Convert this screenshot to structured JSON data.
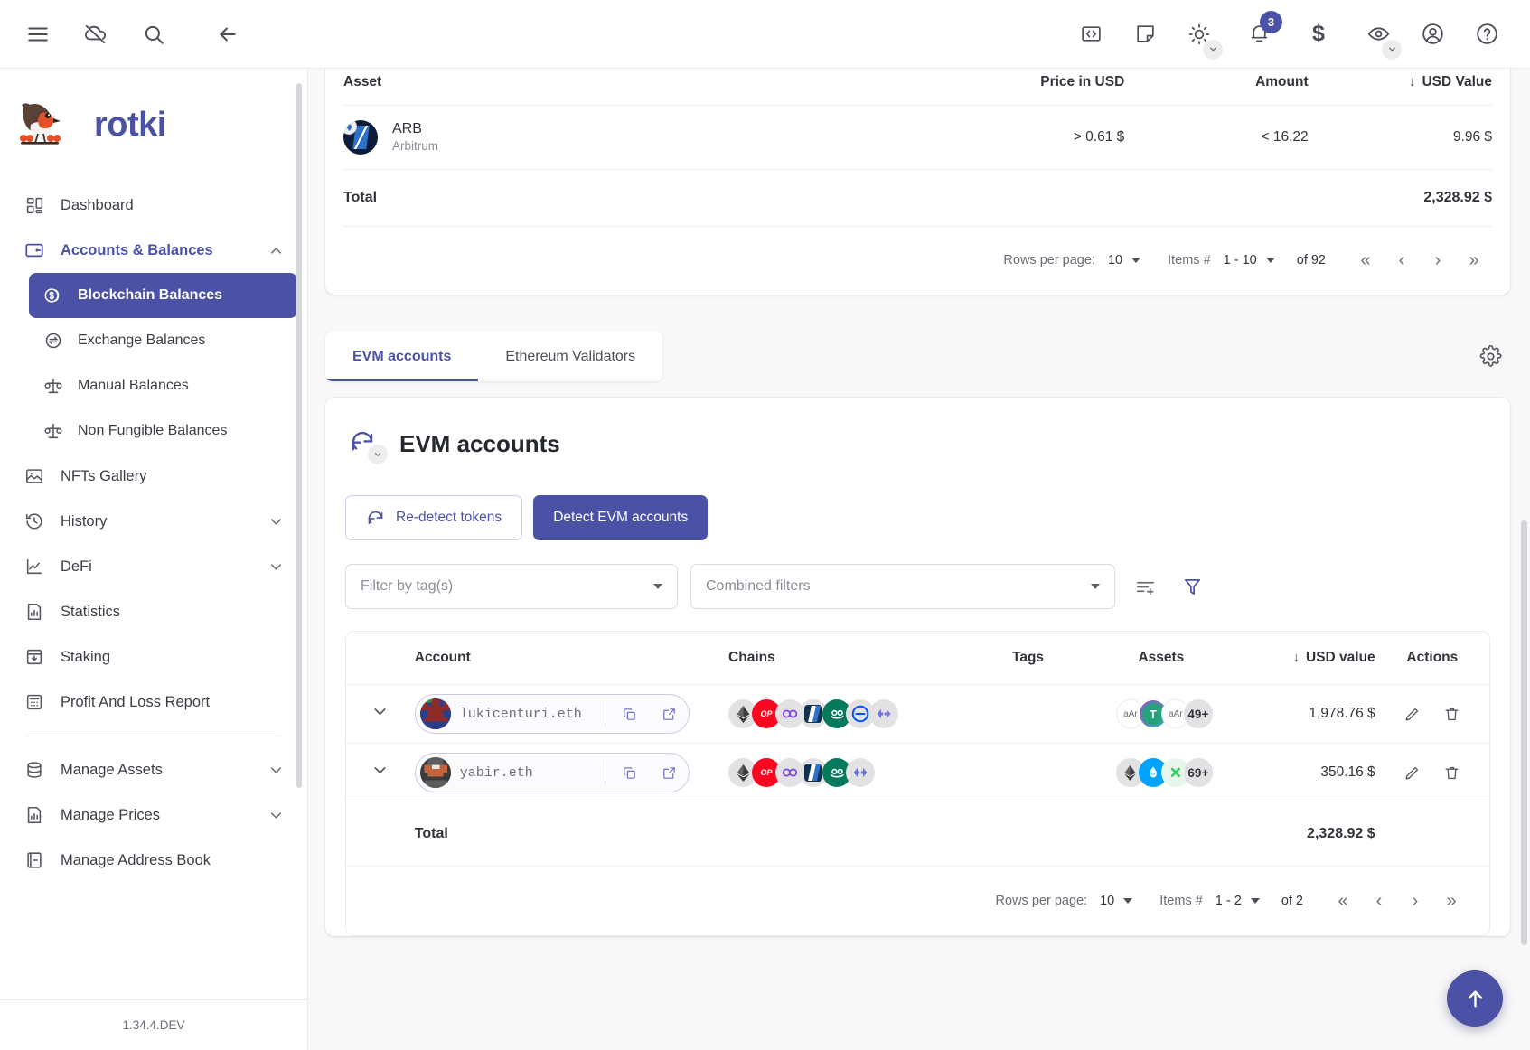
{
  "app": {
    "version": "1.34.4.DEV",
    "brand": "rotki"
  },
  "topbar": {
    "left_icons": [
      "menu-icon",
      "cloud-off-icon",
      "search-icon",
      "back-arrow-icon"
    ],
    "right_icons": [
      "code-icon",
      "notes-icon",
      "theme-brightness-icon",
      "notifications-bell-icon",
      "currency-dollar-icon",
      "privacy-eye-icon",
      "account-circle-icon",
      "help-circle-icon"
    ],
    "notification_count": "3"
  },
  "sidebar": {
    "items": [
      {
        "label": "Dashboard",
        "icon": "dashboard-icon",
        "state": "plain"
      },
      {
        "label": "Accounts & Balances",
        "icon": "wallet-icon",
        "state": "open",
        "chevron": "chevron-up-icon"
      },
      {
        "label": "Blockchain Balances",
        "icon": "coins-icon",
        "state": "active",
        "sub": true
      },
      {
        "label": "Exchange Balances",
        "icon": "exchange-icon",
        "state": "plain",
        "sub": true
      },
      {
        "label": "Manual Balances",
        "icon": "scale-icon",
        "state": "plain",
        "sub": true
      },
      {
        "label": "Non Fungible Balances",
        "icon": "scale-icon",
        "state": "plain",
        "sub": true
      },
      {
        "label": "NFTs Gallery",
        "icon": "image-icon",
        "state": "plain"
      },
      {
        "label": "History",
        "icon": "history-clock-icon",
        "state": "plain",
        "chevron": "chevron-down-icon"
      },
      {
        "label": "DeFi",
        "icon": "line-chart-icon",
        "state": "plain",
        "chevron": "chevron-down-icon"
      },
      {
        "label": "Statistics",
        "icon": "bar-chart-doc-icon",
        "state": "plain"
      },
      {
        "label": "Staking",
        "icon": "inbox-down-icon",
        "state": "plain"
      },
      {
        "label": "Profit And Loss Report",
        "icon": "calculator-icon",
        "state": "plain"
      }
    ],
    "items_lower": [
      {
        "label": "Manage Assets",
        "icon": "database-icon",
        "chevron": "chevron-down-icon"
      },
      {
        "label": "Manage Prices",
        "icon": "bar-chart-doc-icon",
        "chevron": "chevron-down-icon"
      },
      {
        "label": "Manage Address Book",
        "icon": "address-book-icon"
      }
    ]
  },
  "asset_table": {
    "headers": {
      "asset": "Asset",
      "price": "Price in USD",
      "amount": "Amount",
      "usd_value": "USD Value"
    },
    "sort_indicator": "↓",
    "rows": [
      {
        "symbol": "ARB",
        "chain": "Arbitrum",
        "price": "> 0.61 $",
        "amount": "< 16.22",
        "usd_value": "9.96 $"
      }
    ],
    "total_label": "Total",
    "total_value": "2,328.92 $",
    "pagination": {
      "rows_per_page_label": "Rows per page:",
      "rows_per_page_value": "10",
      "items_label": "Items #",
      "items_range": "1 - 10",
      "of_label": "of 92"
    }
  },
  "tabs": {
    "items": [
      {
        "label": "EVM accounts",
        "selected": true
      },
      {
        "label": "Ethereum Validators",
        "selected": false
      }
    ],
    "settings_icon": "gear-icon"
  },
  "evm": {
    "title": "EVM accounts",
    "refresh_icon": "refresh-icon",
    "buttons": {
      "redetect": "Re-detect tokens",
      "detect": "Detect EVM accounts"
    },
    "filters": {
      "tags_placeholder": "Filter by tag(s)",
      "combined_placeholder": "Combined filters",
      "icons": [
        "add-filter-rows-icon",
        "filter-funnel-icon"
      ]
    },
    "table": {
      "headers": {
        "account": "Account",
        "chains": "Chains",
        "tags": "Tags",
        "assets": "Assets",
        "usd_value": "USD value",
        "actions": "Actions"
      },
      "sort_indicator": "↓",
      "rows": [
        {
          "address": "lukicenturi.eth",
          "chains": [
            "ethereum",
            "optimism",
            "polygon",
            "arbitrum",
            "gnosis",
            "base",
            "scroll"
          ],
          "tags": "",
          "assets": [
            "aAr",
            "USDT",
            "aAr"
          ],
          "assets_more": "49+",
          "usd_value": "1,978.76 $"
        },
        {
          "address": "yabir.eth",
          "chains": [
            "ethereum",
            "optimism",
            "polygon",
            "arbitrum",
            "gnosis",
            "scroll"
          ],
          "tags": "",
          "assets": [
            "ETH",
            "LIDO",
            "XDAI"
          ],
          "assets_more": "69+",
          "usd_value": "350.16 $"
        }
      ],
      "total_label": "Total",
      "total_value": "2,328.92 $",
      "pagination": {
        "rows_per_page_label": "Rows per page:",
        "rows_per_page_value": "10",
        "items_label": "Items #",
        "items_range": "1 - 2",
        "of_label": "of 2"
      }
    }
  },
  "fab": {
    "icon": "arrow-up-icon"
  },
  "colors": {
    "accent": "#4b52a5",
    "bg": "#f8f8f9",
    "danger": "#ff0420"
  }
}
